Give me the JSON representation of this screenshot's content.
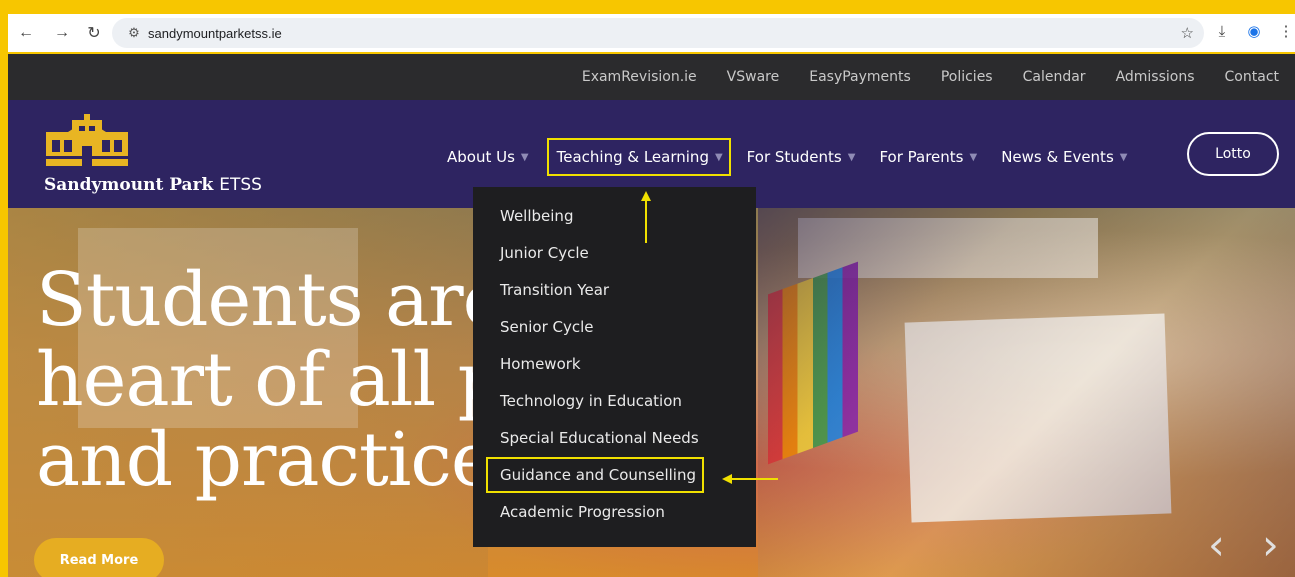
{
  "browser": {
    "url": "sandymountparketss.ie",
    "icons": [
      "back-icon",
      "forward-icon",
      "reload-icon",
      "site-settings-icon",
      "star-icon",
      "download-icon",
      "profile-icon",
      "menu-icon"
    ]
  },
  "topbar": {
    "links": [
      "ExamRevision.ie",
      "VSware",
      "EasyPayments",
      "Policies",
      "Calendar",
      "Admissions",
      "Contact"
    ]
  },
  "logo": {
    "name_bold": "Sandymount Park",
    "name_light": "ETSS"
  },
  "nav": {
    "items": [
      {
        "label": "About Us"
      },
      {
        "label": "Teaching & Learning"
      },
      {
        "label": "For Students"
      },
      {
        "label": "For Parents"
      },
      {
        "label": "News & Events"
      }
    ],
    "lotto_label": "Lotto"
  },
  "dropdown": {
    "items": [
      "Wellbeing",
      "Junior Cycle",
      "Transition Year",
      "Senior Cycle",
      "Homework",
      "Technology in Education",
      "Special Educational Needs",
      "Guidance and Counselling",
      "Academic Progression"
    ]
  },
  "hero": {
    "line1": "Students are",
    "line2": "heart of all p",
    "line3": "and practice",
    "button_label": "Read More"
  },
  "colors": {
    "frame": "#f7c600",
    "header": "#2e2461",
    "topbar": "#2b2b2d",
    "highlight": "#f0e000",
    "button": "#e6ad22"
  }
}
